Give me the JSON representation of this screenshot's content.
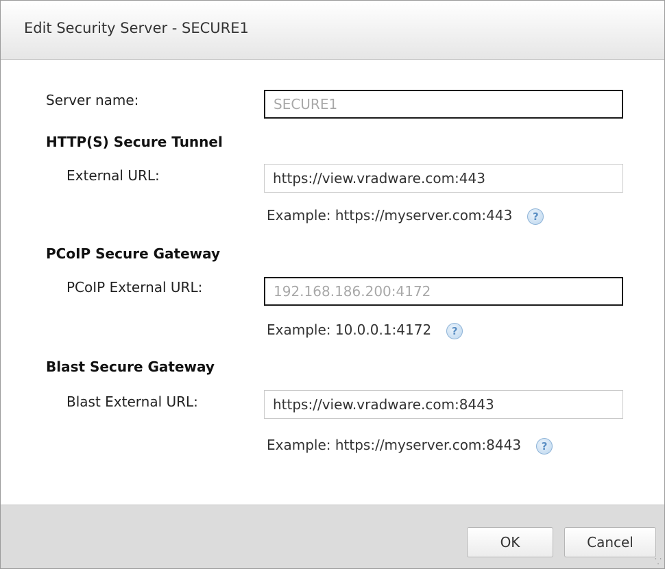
{
  "dialog": {
    "title": "Edit Security Server - SECURE1"
  },
  "server_name": {
    "label": "Server name:",
    "value": "SECURE1"
  },
  "http_tunnel": {
    "heading": "HTTP(S) Secure Tunnel",
    "label": "External URL:",
    "value": "https://view.vradware.com:443",
    "example": "Example: https://myserver.com:443",
    "help_icon": "?"
  },
  "pcoip_gateway": {
    "heading": "PCoIP Secure Gateway",
    "label": "PCoIP External URL:",
    "value": "192.168.186.200:4172",
    "example": "Example: 10.0.0.1:4172",
    "help_icon": "?"
  },
  "blast_gateway": {
    "heading": "Blast Secure Gateway",
    "label": "Blast External URL:",
    "value": "https://view.vradware.com:8443",
    "example": "Example: https://myserver.com:8443",
    "help_icon": "?"
  },
  "footer": {
    "ok_label": "OK",
    "cancel_label": "Cancel"
  }
}
